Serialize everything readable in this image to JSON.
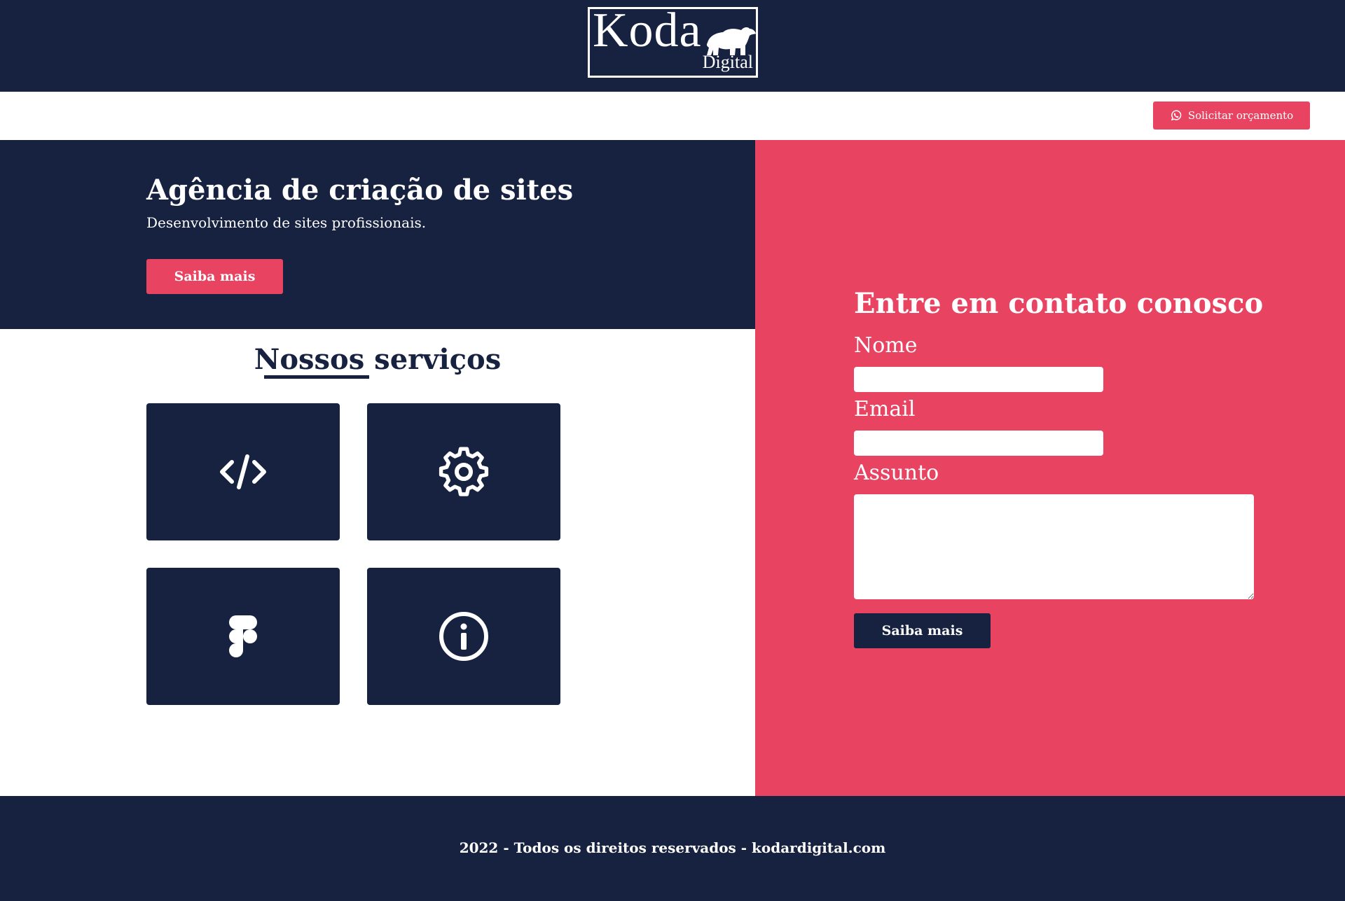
{
  "brand": {
    "logo_name": "Koda",
    "logo_sub": "Digital"
  },
  "topbar": {
    "quote_button": "Solicitar orçamento"
  },
  "hero": {
    "title": "Agência de criação de sites",
    "subtitle": "Desenvolvimento de sites profissionais.",
    "button": "Saiba mais"
  },
  "services": {
    "title": "Nossos serviços",
    "cards": [
      {
        "icon": "code-icon"
      },
      {
        "icon": "gear-icon"
      },
      {
        "icon": "figma-icon"
      },
      {
        "icon": "info-icon"
      }
    ]
  },
  "contact": {
    "title": "Entre em contato conosco",
    "name_label": "Nome",
    "name_value": "",
    "email_label": "Email",
    "email_value": "",
    "subject_label": "Assunto",
    "subject_value": "",
    "button": "Saiba mais"
  },
  "footer": {
    "text": "2022 - Todos os direitos reservados - kodardigital.com"
  },
  "colors": {
    "navy": "#172240",
    "accent": "#e84462",
    "white": "#ffffff"
  }
}
